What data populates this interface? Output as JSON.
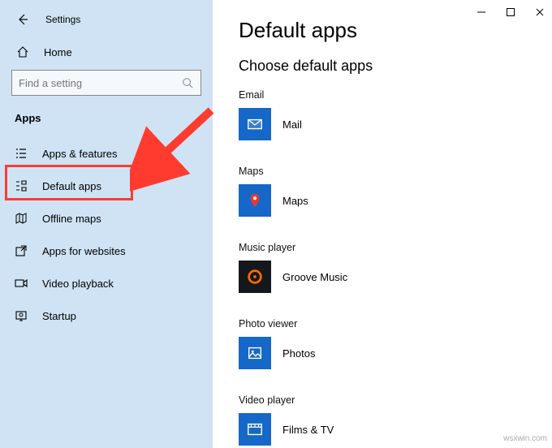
{
  "window": {
    "title": "Settings"
  },
  "sidebar": {
    "home": "Home",
    "search_placeholder": "Find a setting",
    "section": "Apps",
    "items": [
      {
        "label": "Apps & features"
      },
      {
        "label": "Default apps"
      },
      {
        "label": "Offline maps"
      },
      {
        "label": "Apps for websites"
      },
      {
        "label": "Video playback"
      },
      {
        "label": "Startup"
      }
    ]
  },
  "page": {
    "title": "Default apps",
    "subtitle": "Choose default apps",
    "categories": [
      {
        "label": "Email",
        "app": "Mail",
        "tile": "#1568c7"
      },
      {
        "label": "Maps",
        "app": "Maps",
        "tile": "#1568c7"
      },
      {
        "label": "Music player",
        "app": "Groove Music",
        "tile": "#1568c7"
      },
      {
        "label": "Photo viewer",
        "app": "Photos",
        "tile": "#1568c7"
      },
      {
        "label": "Video player",
        "app": "Films & TV",
        "tile": "#1568c7"
      }
    ]
  },
  "watermark": "wsxwin.com"
}
